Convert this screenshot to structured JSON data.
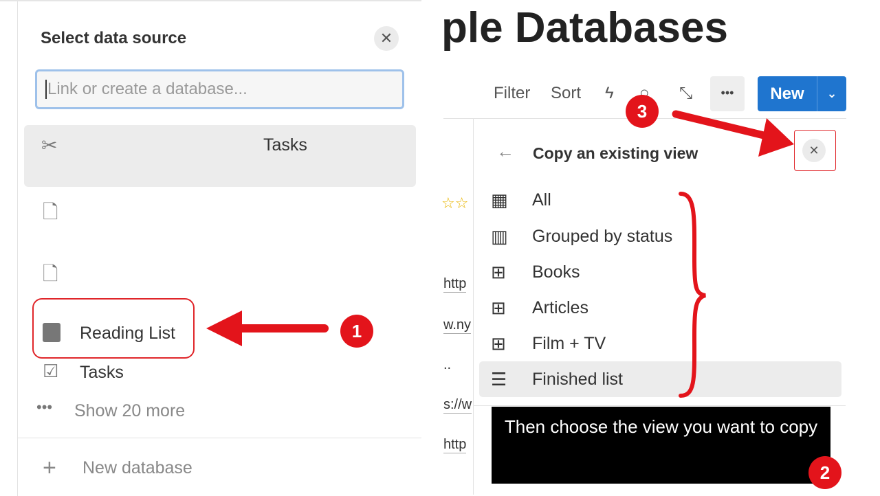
{
  "left_panel": {
    "title": "Select data source",
    "search_placeholder": "Link or create a database...",
    "items": [
      {
        "icon": "scissors-icon",
        "label": "Tasks"
      },
      {
        "icon": "document-icon",
        "label": ""
      },
      {
        "icon": "document-icon",
        "label": ""
      },
      {
        "icon": "database-icon",
        "label": "Reading List"
      },
      {
        "icon": "checkbox-icon",
        "label": "Tasks"
      }
    ],
    "show_more": "Show 20 more",
    "new_database": "New database"
  },
  "page": {
    "title_fragment": "ple Databases",
    "toolbar": {
      "filter": "Filter",
      "sort": "Sort",
      "new": "New"
    },
    "row_fragments": [
      "http",
      "w.ny",
      "..",
      "s://w",
      "http"
    ]
  },
  "copy_view_panel": {
    "title": "Copy an existing view",
    "views": [
      {
        "icon": "table-icon",
        "label": "All"
      },
      {
        "icon": "board-icon",
        "label": "Grouped by status"
      },
      {
        "icon": "gallery-icon",
        "label": "Books"
      },
      {
        "icon": "gallery-icon",
        "label": "Articles"
      },
      {
        "icon": "gallery-icon",
        "label": "Film + TV"
      },
      {
        "icon": "list-icon",
        "label": "Finished list"
      }
    ]
  },
  "annotations": {
    "step1": "1",
    "step2": "2",
    "step3": "3",
    "caption": "Then choose the view you want to copy",
    "accent": "#e3141b"
  }
}
